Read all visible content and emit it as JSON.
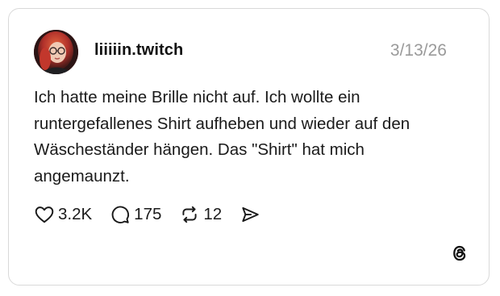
{
  "post": {
    "username": "liiiiin.twitch",
    "date": "3/13/26",
    "text": "Ich hatte meine Brille nicht auf. Ich wollte ein runtergefallenes Shirt aufheben und wieder auf den Wäscheständer hängen. Das \"Shirt\" hat mich angemaunzt.",
    "avatar_icon": "profile-photo"
  },
  "actions": {
    "like": {
      "icon": "heart-icon",
      "count": "3.2K"
    },
    "comment": {
      "icon": "comment-bubble-icon",
      "count": "175"
    },
    "repost": {
      "icon": "repost-icon",
      "count": "12"
    },
    "share": {
      "icon": "send-icon"
    }
  },
  "brand": {
    "icon": "threads-logo-icon"
  },
  "colors": {
    "text": "#1a1a1a",
    "muted": "#9a9a9a",
    "border": "#d9d9d9"
  }
}
